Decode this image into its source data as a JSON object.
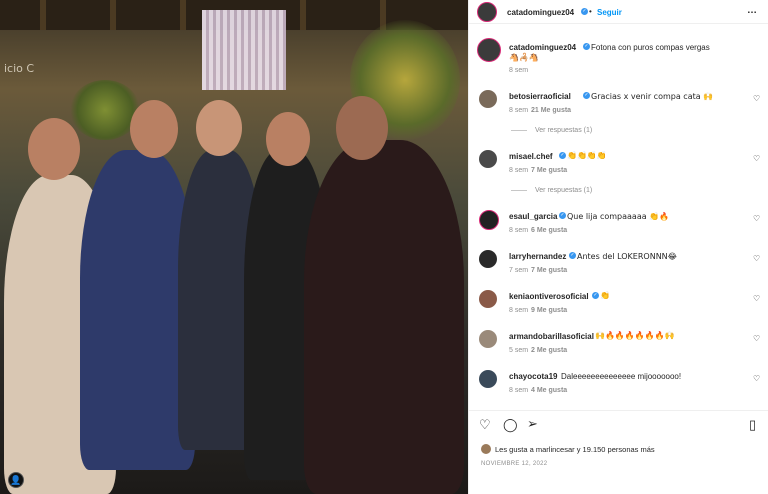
{
  "header": {
    "username": "catadominguez04",
    "dot": "•",
    "follow_label": "Seguir",
    "more_icon": "…"
  },
  "photo": {
    "sign_text": "icio C"
  },
  "caption": {
    "username": "catadominguez04",
    "text": "Fotona con puros compas vergas",
    "emojis": "🐴🦂🐴",
    "age": "8 sem"
  },
  "comments": [
    {
      "username": "betosierraoficial",
      "verified": true,
      "text": "Gracias x venir compa cata 🙌",
      "age": "8 sem",
      "likes": "21 Me gusta",
      "replies": "Ver respuestas (1)"
    },
    {
      "username": "misael.chef",
      "verified": true,
      "text": "👏👏👏👏",
      "age": "8 sem",
      "likes": "7 Me gusta",
      "replies": "Ver respuestas (1)"
    },
    {
      "username": "esaul_garcia",
      "verified": true,
      "text": "Que lija compaaaaa 👏🔥",
      "age": "8 sem",
      "likes": "6 Me gusta"
    },
    {
      "username": "larryhernandez",
      "verified": true,
      "text": "Antes del LOKERONNN😂",
      "age": "7 sem",
      "likes": "7 Me gusta"
    },
    {
      "username": "keniaontiverosoficial",
      "verified": true,
      "text": "👏",
      "age": "8 sem",
      "likes": "9 Me gusta"
    },
    {
      "username": "armandobarillasoficial",
      "verified": false,
      "text": "🙌🔥🔥🔥🔥🔥🔥🙌",
      "age": "5 sem",
      "likes": "2 Me gusta"
    },
    {
      "username": "chayocota19",
      "verified": false,
      "text": "Daleeeeeeeeeeeeee mijooooooo!",
      "age": "8 sem",
      "likes": "4 Me gusta"
    }
  ],
  "actions": {
    "like_icon": "heart-icon",
    "comment_icon": "comment-icon",
    "share_icon": "share-icon",
    "save_icon": "bookmark-icon"
  },
  "likes_text": "Les gusta a marlincesar y 19.150 personas más",
  "date": "NOVIEMBRE 12, 2022",
  "colors": {
    "accent": "#0095f6",
    "verified": "#3897f0",
    "text": "#262626",
    "muted": "#8e8e8e"
  }
}
